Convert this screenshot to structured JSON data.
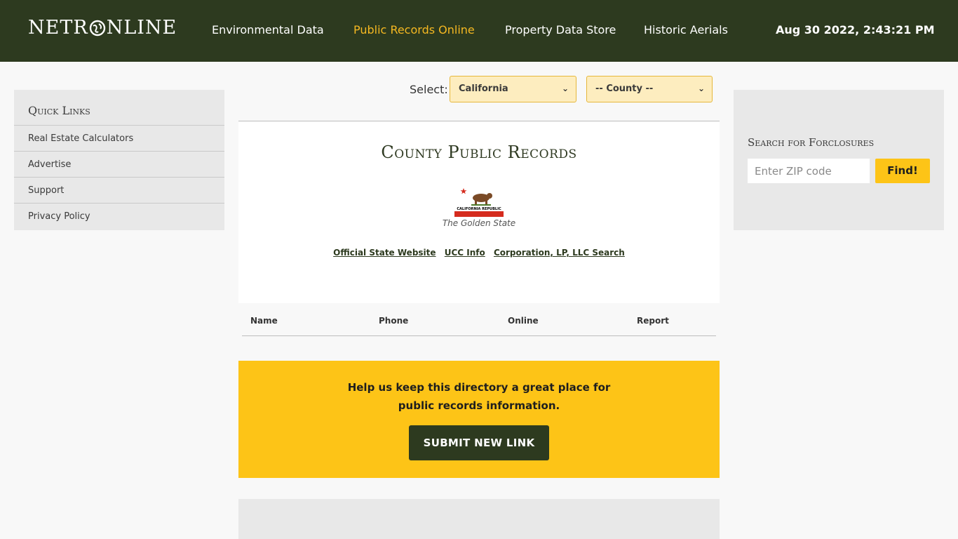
{
  "header": {
    "logo_text_left": "NETR",
    "logo_text_right": "NLINE",
    "nav": [
      {
        "label": "Environmental Data",
        "active": false
      },
      {
        "label": "Public Records Online",
        "active": true
      },
      {
        "label": "Property Data Store",
        "active": false
      },
      {
        "label": "Historic Aerials",
        "active": false
      }
    ],
    "datetime": "Aug 30 2022, 2:43:21 PM"
  },
  "quick_links": {
    "title": "Quick Links",
    "items": [
      "Real Estate Calculators",
      "Advertise",
      "Support",
      "Privacy Policy"
    ]
  },
  "selectors": {
    "label": "Select:",
    "state": "California",
    "county": "-- County --"
  },
  "main": {
    "title": "County Public Records",
    "flag_text": "CALIFORNIA REPUBLIC",
    "nickname": "The Golden State",
    "links": [
      "Official State Website",
      "UCC Info",
      "Corporation, LP, LLC Search"
    ],
    "table_headers": [
      "Name",
      "Phone",
      "Online",
      "Report"
    ]
  },
  "help": {
    "line1": "Help us keep this directory a great place for",
    "line2": "public records information.",
    "button": "SUBMIT NEW LINK"
  },
  "foreclosure": {
    "title": "Search for Forclosures",
    "placeholder": "Enter ZIP code",
    "button": "Find!"
  },
  "colors": {
    "header_bg": "#2d3a1f",
    "accent": "#fdc417",
    "nav_active": "#f5b821"
  }
}
